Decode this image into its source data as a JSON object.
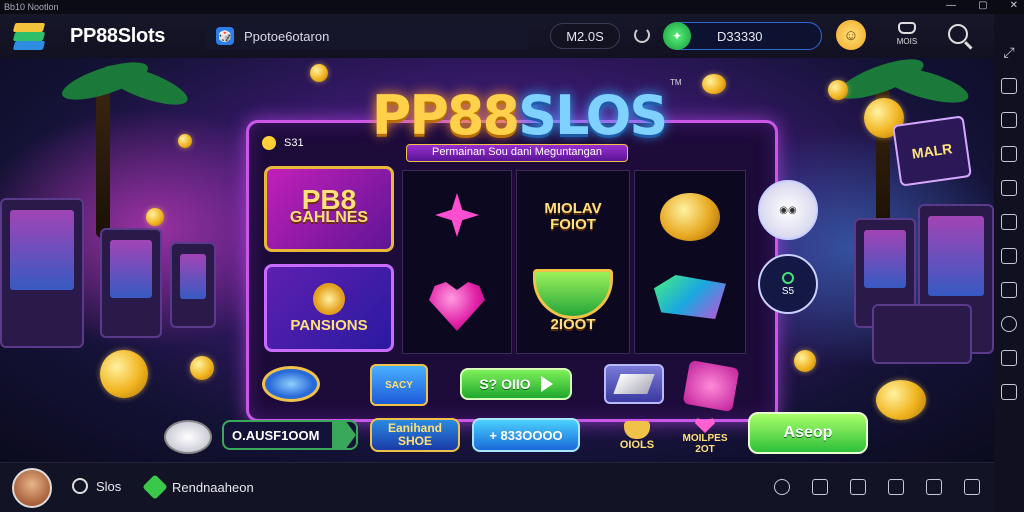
{
  "window": {
    "title": "Bb10 Nootlon",
    "controls": [
      "—",
      "▢",
      "✕"
    ]
  },
  "topbar": {
    "app_title": "PP88Slots",
    "tab_label": "Ppotoe6otaron",
    "level_pill": "M2.0S",
    "coins_value": "D33330",
    "bag_label": "MOIS"
  },
  "game": {
    "logo_left": "PP88",
    "logo_right": "SLOS",
    "logo_tm": "TM",
    "subtitle": "Permainan Sou dani Meguntangan",
    "board_level": "S31",
    "card_games_big": "PB8",
    "card_games": "GAHLNES",
    "card_fans": "PANSIONS",
    "reel3_top": "MIOLAV FOIOT",
    "reel3_bottom": "2IOOT",
    "badge_bottom": "S5",
    "mini_icon_1": "SACY",
    "play_button": "S? OIIO",
    "neon_sign": "MALR"
  },
  "bottom_controls": {
    "chip_a": "O.AUSF1OOM",
    "chip_b_line1": "Eanihand",
    "chip_b_line2": "SHOE",
    "chip_c": "+ 833OOOO",
    "chip_d": "OIOLS",
    "chip_e_line1": "MOILPES",
    "chip_e_line2": "2OT",
    "buy_button": "Aseop"
  },
  "bottombar": {
    "item1": "Slos",
    "item2": "Rendnaaheon"
  },
  "colors": {
    "accent_green": "#2fbf3a",
    "accent_gold": "#f1c24a",
    "accent_magenta": "#c957e8"
  }
}
